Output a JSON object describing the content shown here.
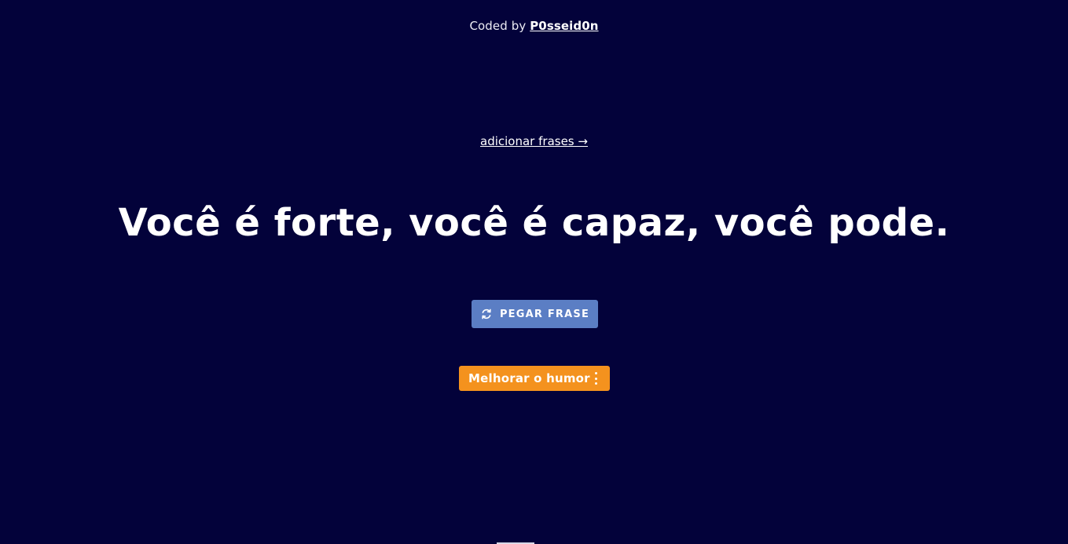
{
  "header": {
    "credit_prefix": "Coded by",
    "author": "P0sseid0n"
  },
  "nav": {
    "add_phrases_link": "adicionar frases →"
  },
  "main": {
    "quote": "Você é forte, você é capaz, você pode."
  },
  "actions": {
    "get_phrase_label": "PEGAR FRASE",
    "get_phrase_icon": "refresh-icon",
    "mood_label": "Melhorar o humor",
    "mood_menu_icon": "more-vertical-icon"
  },
  "colors": {
    "background": "#03023a",
    "primary_button": "#5b7ec4",
    "mood_button": "#f4921e",
    "text": "#ffffff"
  }
}
